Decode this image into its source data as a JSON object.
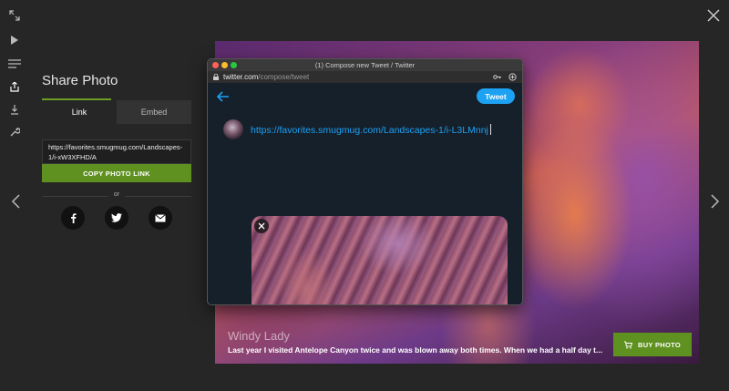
{
  "toolbar": {
    "icons": [
      "fullscreen-icon",
      "play-icon",
      "menu-icon",
      "share-icon",
      "download-icon",
      "tools-icon"
    ]
  },
  "share": {
    "title": "Share Photo",
    "tabs": [
      {
        "label": "Link",
        "active": true
      },
      {
        "label": "Embed",
        "active": false
      }
    ],
    "link_value": "https://favorites.smugmug.com/Landscapes-1/i-xW3XFHD/A",
    "copy_button": "COPY PHOTO LINK",
    "or_label": "or",
    "social": [
      "facebook-icon",
      "twitter-icon",
      "email-icon"
    ]
  },
  "browser": {
    "window_title": "(1) Compose new Tweet / Twitter",
    "url_host": "twitter.com",
    "url_path": "/compose/tweet",
    "tweet_button": "Tweet",
    "tweet_text": "https://favorites.smugmug.com/Landscapes-1/i-L3LMnnj"
  },
  "photo": {
    "title": "Windy Lady",
    "description": "Last year I visited Antelope Canyon twice and was blown away both times. When we had a half day t...",
    "buy_button": "BUY PHOTO"
  },
  "colors": {
    "accent_green": "#5f9120",
    "twitter_blue": "#1da1f2",
    "background": "#262626"
  }
}
